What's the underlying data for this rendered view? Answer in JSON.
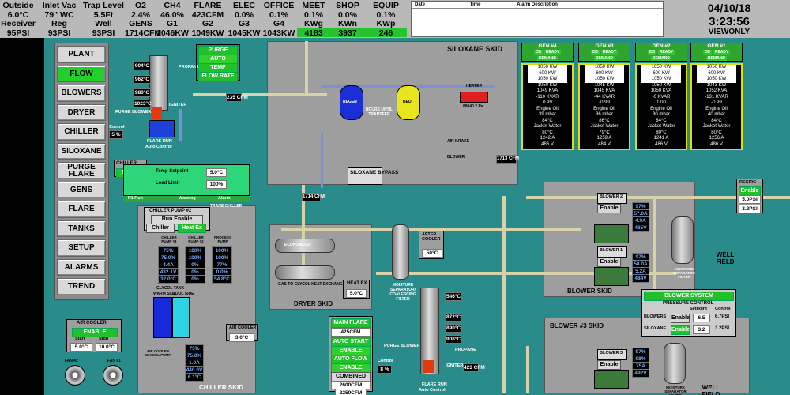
{
  "header": {
    "row1_labels": [
      "Outside",
      "Inlet Vac",
      "Trap Level",
      "O2",
      "CH4",
      "FLARE",
      "ELEC",
      "OFFICE",
      "MEET",
      "SHOP",
      "EQUIP"
    ],
    "row1_values": [
      "6.0°C",
      "79\" WC",
      "5.5Ft",
      "2.4%",
      "46.0%",
      "423CFM",
      "0.0%",
      "0.1%",
      "0.1%",
      "0.0%",
      "0.1%"
    ],
    "row2_labels": [
      "Receiver",
      "Reg",
      "Well",
      "GENS",
      "G1",
      "G2",
      "G3",
      "G4",
      "KWg",
      "KWn",
      "KWp"
    ],
    "row2_values": [
      "95PSI",
      "93PSI",
      "93PSI",
      "1714CFM",
      "1046KW",
      "1049KW",
      "1045KW",
      "1043KW",
      "4183",
      "3937",
      "246"
    ],
    "g3_indicator": "●"
  },
  "alarm_table": {
    "columns": [
      "Date",
      "Time",
      "Alarm Description"
    ]
  },
  "datetime": {
    "date": "04/10/18",
    "time": "3:23:56",
    "mode": "VIEWONLY"
  },
  "nav": {
    "items": [
      "PLANT",
      "FLOW",
      "BLOWERS",
      "DRYER",
      "CHILLER",
      "SILOXANE",
      "PURGE FLARE",
      "GENS",
      "FLARE",
      "TANKS",
      "SETUP",
      "ALARMS",
      "TREND"
    ],
    "active": "FLOW"
  },
  "purge": {
    "title": "PURGE FLARE",
    "mode": "AUTO",
    "temp_control": "TEMP CONTROL",
    "flow_rate": "FLOW RATE",
    "purge_blower": "PURGE BLOWER",
    "propane": "PROPANE",
    "igniter": "IGNITER",
    "flare_run": "FLARE RUN",
    "auto_control": "Auto Control",
    "control": "Control",
    "control_val": "5 %",
    "temps": [
      "904°C",
      "962°C",
      "980°C",
      "1023°C"
    ],
    "flow": "235 CFM"
  },
  "siloxane": {
    "title": "SILOXANE SKID",
    "bypass_label": "SILOXANE BYPASS",
    "bypass_val": "BYPASS",
    "regen": "REGEN",
    "bed": "BED",
    "hours": "HOURS UNTIL TRANSFER",
    "tank_reading": "88040.2 Pa",
    "heater": "HEATER",
    "air_intake": "AIR INTAKE",
    "blower": "BLOWER"
  },
  "chiller": {
    "title": "CHILLER",
    "enable": "Enable",
    "temp_setpoint_label": "Temp Setpoint",
    "temp_setpoint": "5.0°C",
    "load_limit_label": "Load Limit",
    "load_limit": "100%",
    "p1_run": "P1 Run",
    "warning": "Warning",
    "alarm": "Alarm",
    "trane": "TRANE CHILLER",
    "pump_title": "CHILLER PUMP #2",
    "run_enable": "Run Enable",
    "chiller_btn": "Chiller",
    "heatex_btn": "Heat Ex",
    "skid": "CHILLER SKID",
    "glycol_tank": "GLYCOL TANK",
    "warm_side": "WARM SIDE",
    "cool_side": "COOL SIDE",
    "pump1": "CHILLER PUMP #1",
    "pump2": "CHILLER PUMP #2",
    "process_pump": "PROCESS PUMP",
    "pump_vals1": [
      "75%",
      "75.0%",
      "4.4A",
      "432.1V",
      "32.0°C"
    ],
    "pump_vals2": [
      "100%",
      "100%",
      "0%",
      "0%",
      "0%"
    ],
    "pump_vals3": [
      "100%",
      "100%",
      "77%",
      "0.0%",
      "54.8°C"
    ],
    "glycol_pump": "AIR COOLER GLYCOL PUMP",
    "glycol_vals": [
      "75%",
      "75.0%",
      "1.0A",
      "440.0V",
      "6.1°C"
    ]
  },
  "dryer": {
    "skid": "DRYER SKID",
    "gas_heatex": "GAS TO GLYCOL HEAT EXCHANGER",
    "economizer": "ECONOMIZER",
    "heatex": "HEAT EX",
    "heatex_val": "5.0°C",
    "moisture": "MOISTURE SEPARATOR/ COALESCING FILTER",
    "after_cooler": "AFTER COOLER",
    "after_cooler_val": "50°C",
    "cfm": "1714 CFM",
    "cfm2": "1713 CFM"
  },
  "main_flare": {
    "title": "MAIN FLARE",
    "value": "425CFM",
    "auto_start": "AUTO START",
    "enable1": "ENABLE",
    "auto_flow": "AUTO FLOW",
    "enable2": "ENABLE",
    "combined": "COMBINED",
    "combined_val": "2600CFM",
    "bottom_val": "2250CFM",
    "purge_blower": "PURGE BLOWER",
    "control": "Control",
    "control_val": "8 %",
    "propane": "PROPANE",
    "igniter": "IGNITER",
    "flare_run": "FLARE RUN",
    "auto_control": "Auto Control",
    "flow": "423 CFM",
    "temps": [
      "546°C",
      "872°C",
      "890°C",
      "908°C"
    ]
  },
  "air_cooler": {
    "title": "AIR COOLER",
    "enable": "ENABLE",
    "start_label": "Start",
    "stop_label": "Stop",
    "start": "5.0°C",
    "stop": "10.0°C",
    "fan2": "FAN #2",
    "fan1": "FAN #1",
    "air_cooler2": "AIR COOLER",
    "air_cooler2_val": "3.0°C"
  },
  "gens": [
    {
      "name": "GEN #4",
      "kw": "1050 KW",
      "kw2": "600 KW",
      "kw3": "1050 KW",
      "vals": [
        "1050 KW",
        "1049 KVA",
        "-110 KVAR"
      ],
      "pf": "0.99",
      "mbar": "39 mbar",
      "c1": "84°C",
      "c2": "80°C",
      "eng": "Engine Oil",
      "jw": "Jacket Water",
      "ia": "1242 A",
      "v": "486 V"
    },
    {
      "name": "GEN #3",
      "kw": "1050 KW",
      "kw2": "600 KW",
      "kw3": "1050 KW",
      "vals": [
        "1045 KW",
        "1045 KVA",
        "-44 KVAR"
      ],
      "pf": "-0.99",
      "mbar": "36 mbar",
      "c1": "86°C",
      "c2": "79°C",
      "eng": "Engine Oil",
      "jw": "Jacket Water",
      "ia": "1259 A",
      "v": "484 V"
    },
    {
      "name": "GEN #2",
      "kw": "1050 KW",
      "kw2": "600 KW",
      "kw3": "1050 KW",
      "vals": [
        "1050 KW",
        "1050 KVA",
        "-0 KVAR"
      ],
      "pf": "1.00",
      "mbar": "30 mbar",
      "c1": "84°C",
      "c2": "80°C",
      "eng": "Engine Oil",
      "jw": "Jacket Water",
      "ia": "1241 A",
      "v": "486 V"
    },
    {
      "name": "GEN #1",
      "kw": "1050 KW",
      "kw2": "600 KW",
      "kw3": "1050 KW",
      "vals": [
        "1043 KW",
        "1052 KVA",
        "-131 KVAR"
      ],
      "pf": "-0.99",
      "mbar": "40 mbar",
      "c1": "84°C",
      "c2": "80°C",
      "eng": "Engine Oil",
      "jw": "Jacket Water",
      "ia": "1256 A",
      "v": "486 V"
    }
  ],
  "gen_buttons": [
    "CB",
    "READY",
    "DEMAND"
  ],
  "blowers": {
    "title": "BLOWER SKID",
    "blower2": "BLOWER 2",
    "blower1": "BLOWER 1",
    "blower3": "BLOWER 3",
    "enable": "Enable",
    "b3_skid": "BLOWER #3 SKID",
    "moisture": "MOISTURE SEPARATOR FILTER",
    "well_field": "WELL FIELD",
    "recirc": "RECIRC",
    "recirc_enable": "Enable",
    "recirc_val": "5.0PSI",
    "recirc_val2": "3.2PSI",
    "vals2": [
      "97%",
      "57.0A",
      "4.9A",
      "485V"
    ],
    "vals1": [
      "97%",
      "58.0A",
      "5.2A",
      "484V"
    ],
    "vals3": [
      "97%",
      "98%",
      "75A",
      "492V"
    ]
  },
  "blower_system": {
    "title": "BLOWER SYSTEM",
    "pressure_control": "PRESSURE CONTROL",
    "setpoint": "Setpoint",
    "control": "Control",
    "blowers": "BLOWERS",
    "siloxane": "SILOXANE",
    "enable": "Enable",
    "b_setpoint": "6.5",
    "b_control": "6.7PSI",
    "s_setpoint": "3.2",
    "s_control": "3.2PSI"
  },
  "colors": {
    "panel_bg": "#2a8c8a",
    "active_green": "#22d02c",
    "gray": "#9e9e9e"
  }
}
